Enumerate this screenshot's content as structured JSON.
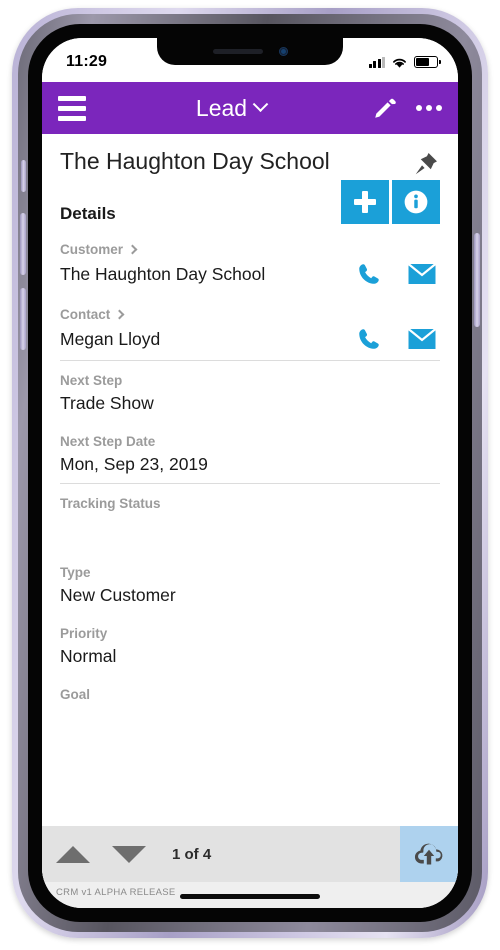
{
  "status_bar": {
    "time": "11:29",
    "signal_icon": "cellular-signal-icon",
    "signal_bars_filled": 3,
    "signal_bars_total": 4,
    "wifi_icon": "wifi-icon",
    "battery_icon": "battery-icon",
    "battery_percent": 65
  },
  "app_bar": {
    "menu_icon": "hamburger-menu-icon",
    "title": "Lead",
    "title_chevron_icon": "chevron-down-icon",
    "edit_icon": "pencil-edit-icon",
    "overflow_icon": "more-options-icon",
    "background_color": "#7b26bc"
  },
  "record": {
    "title": "The Haughton Day School",
    "pin_icon": "pushpin-icon"
  },
  "details": {
    "label": "Details",
    "add_label": "+",
    "add_icon": "plus-icon",
    "info_icon": "info-circle-icon",
    "accent_color": "#1ba0d8"
  },
  "fields": [
    {
      "label": "Customer",
      "has_chevron": true,
      "value": "The Haughton Day School",
      "phone_icon": "phone-icon",
      "email_icon": "envelope-icon",
      "has_actions": true,
      "rule": false
    },
    {
      "label": "Contact",
      "has_chevron": true,
      "value": "Megan Lloyd",
      "phone_icon": "phone-icon",
      "email_icon": "envelope-icon",
      "has_actions": true,
      "rule": true
    },
    {
      "label": "Next Step",
      "has_chevron": false,
      "value": "Trade Show",
      "has_actions": false,
      "rule": false
    },
    {
      "label": "Next Step Date",
      "has_chevron": false,
      "value": "Mon, Sep 23, 2019",
      "has_actions": false,
      "rule": true
    },
    {
      "label": "Tracking Status",
      "has_chevron": false,
      "value": "",
      "has_actions": false,
      "rule": false
    },
    {
      "label": "Type",
      "has_chevron": false,
      "value": "New Customer",
      "has_actions": false,
      "rule": false
    },
    {
      "label": "Priority",
      "has_chevron": false,
      "value": "Normal",
      "has_actions": false,
      "rule": false
    },
    {
      "label": "Goal",
      "has_chevron": false,
      "value": "",
      "has_actions": false,
      "rule": false
    }
  ],
  "bottom_bar": {
    "prev_icon": "triangle-up-icon",
    "next_icon": "triangle-down-icon",
    "pager_text": "1 of 4",
    "release_note": "CRM v1 ALPHA RELEASE",
    "sync_icon": "cloud-upload-icon",
    "sync_background_color": "#aed2ee"
  }
}
